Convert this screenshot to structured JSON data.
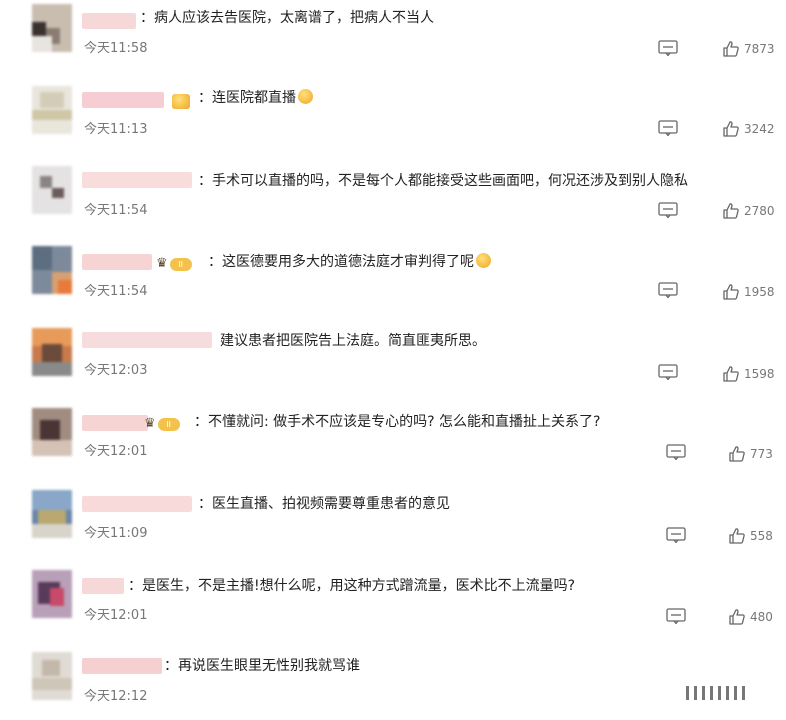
{
  "icons": {
    "reply": "comment-bubble-icon",
    "like": "thumbs-up-icon"
  },
  "comments": [
    {
      "text": "：病人应该去告医院，太离谱了，把病人不当人",
      "time": "今天11:58",
      "likes": "7873"
    },
    {
      "text": "：连医院都直播",
      "time": "今天11:13",
      "likes": "3242"
    },
    {
      "text": "：手术可以直播的吗，不是每个人都能接受这些画面吧，何况还涉及到别人隐私",
      "time": "今天11:54",
      "likes": "2780"
    },
    {
      "text": "：这医德要用多大的道德法庭才审判得了呢",
      "time": "今天11:54",
      "likes": "1958"
    },
    {
      "text": "建议患者把医院告上法庭。简直匪夷所思。",
      "time": "今天12:03",
      "likes": "1598"
    },
    {
      "text": "：不懂就问: 做手术不应该是专心的吗? 怎么能和直播扯上关系了?",
      "time": "今天12:01",
      "likes": "773"
    },
    {
      "text": "：医生直播、拍视频需要尊重患者的意见",
      "time": "今天11:09",
      "likes": "558"
    },
    {
      "text": "：是医生，不是主播!想什么呢，用这种方式蹭流量，医术比不上流量吗?",
      "time": "今天12:01",
      "likes": "480"
    },
    {
      "text": "：再说医生眼里无性别我就骂谁",
      "time": "今天12:12",
      "likes": ""
    }
  ],
  "badges": {
    "level_label": "II"
  }
}
